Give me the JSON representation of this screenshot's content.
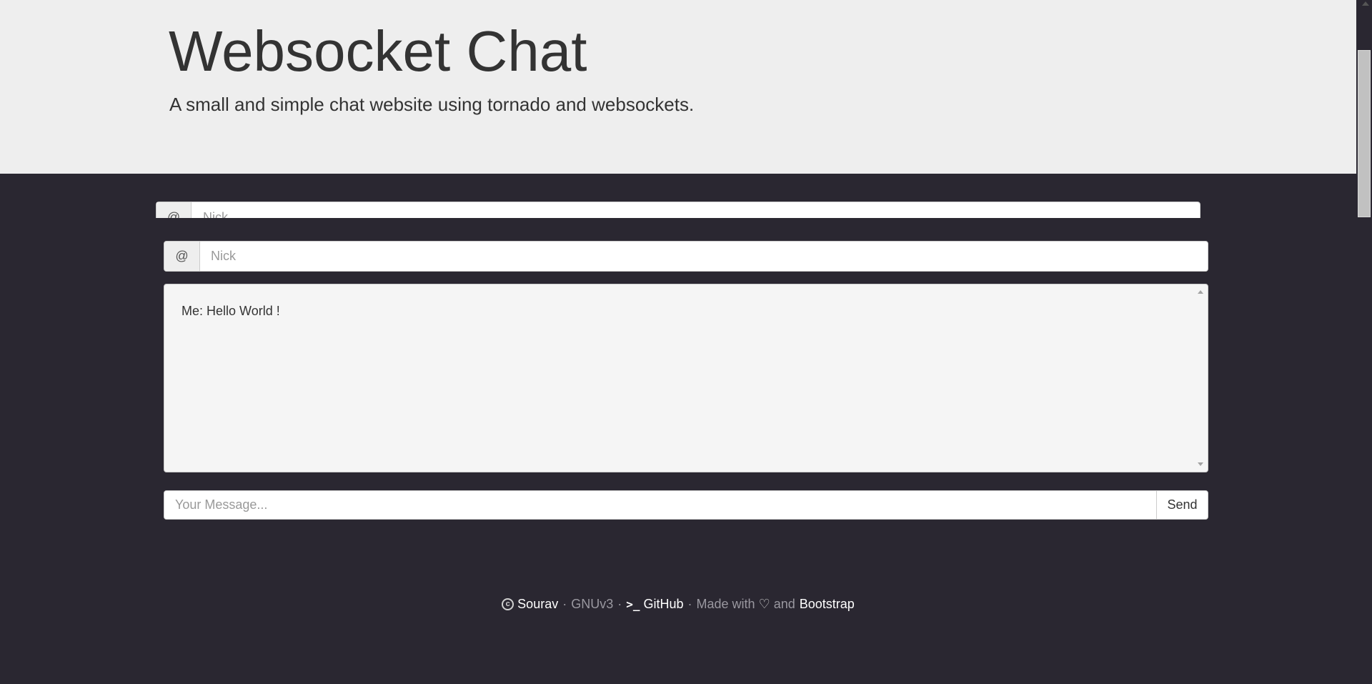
{
  "header": {
    "title": "Websocket Chat",
    "subtitle": "A small and simple chat website using tornado and websockets."
  },
  "ghost_nick": {
    "addon": "@",
    "placeholder": "Nick"
  },
  "nick": {
    "addon": "@",
    "placeholder": "Nick",
    "value": ""
  },
  "chat": {
    "messages": [
      "Me: Hello World !"
    ]
  },
  "message_input": {
    "placeholder": "Your Message...",
    "value": "",
    "send_label": "Send"
  },
  "footer": {
    "author": "Sourav",
    "license": "GNUv3",
    "github": "GitHub",
    "made_with": "Made with",
    "and": "and",
    "bootstrap": "Bootstrap",
    "separator": "·"
  },
  "icons": {
    "copyright": "copyright-icon",
    "terminal": "terminal-icon",
    "heart": "heart-icon"
  },
  "colors": {
    "header_bg": "#eeeeee",
    "body_bg": "#2a2731",
    "chat_bg": "#f5f5f5",
    "footer_muted": "#9a98a0",
    "footer_link": "#ffffff"
  }
}
